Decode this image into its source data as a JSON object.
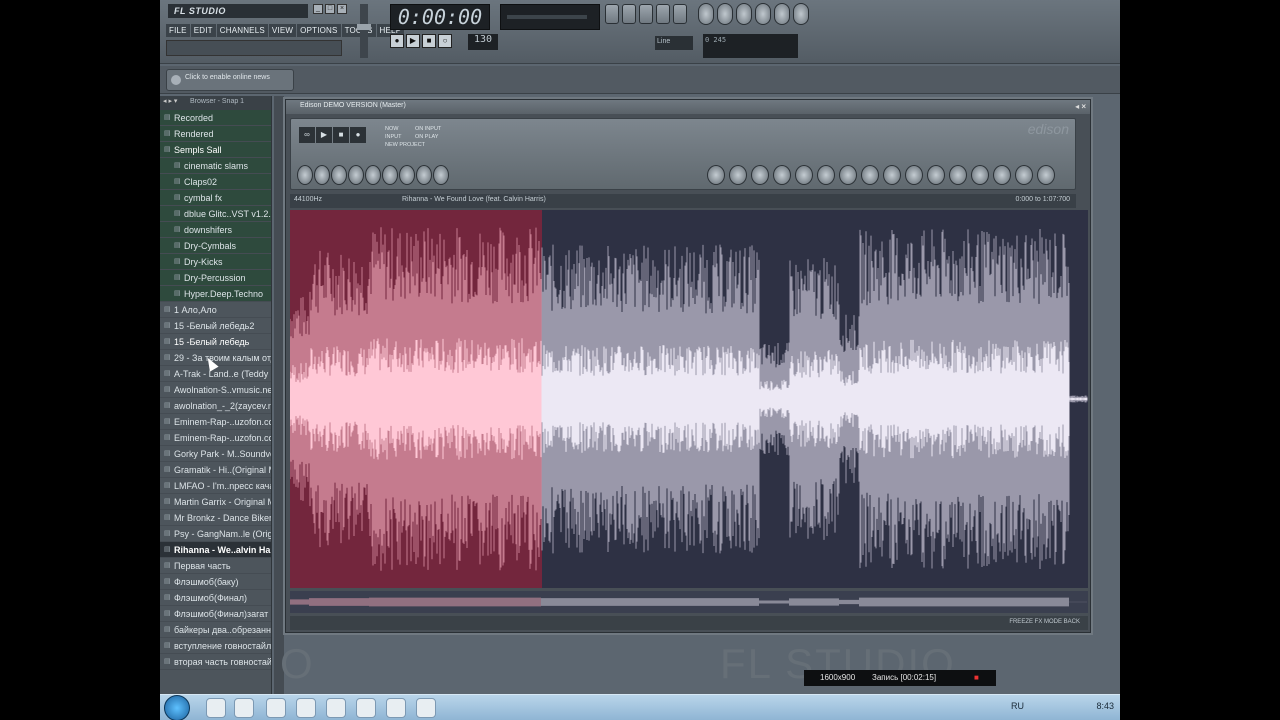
{
  "app": {
    "logo": "FL STUDIO",
    "menu": [
      "FILE",
      "EDIT",
      "CHANNELS",
      "VIEW",
      "OPTIONS",
      "TOOLS",
      "HELP"
    ],
    "time": "0:00:00",
    "tempo": "130",
    "pattern_label": "Line",
    "cpu_readout": "0 245",
    "news": "Click to enable online news"
  },
  "browser": {
    "title": "Browser - Snap 1",
    "items": [
      {
        "label": "Recorded",
        "kind": "folder"
      },
      {
        "label": "Rendered",
        "kind": "folder"
      },
      {
        "label": "Sempls Sall",
        "kind": "folder-bold"
      },
      {
        "label": "cinematic slams",
        "kind": "sub"
      },
      {
        "label": "Claps02",
        "kind": "sub"
      },
      {
        "label": "cymbal fx",
        "kind": "sub"
      },
      {
        "label": "dblue Glitc..VST v1.2.1",
        "kind": "sub"
      },
      {
        "label": "downshifers",
        "kind": "sub"
      },
      {
        "label": "Dry-Cymbals",
        "kind": "sub"
      },
      {
        "label": "Dry-Kicks",
        "kind": "sub"
      },
      {
        "label": "Dry-Percussion",
        "kind": "sub"
      },
      {
        "label": "Hyper.Deep.Techno",
        "kind": "sub"
      },
      {
        "label": "1 Ало,Ало",
        "kind": "file"
      },
      {
        "label": "15 -Белый лебедь2",
        "kind": "file"
      },
      {
        "label": "15 -Белый лебедь",
        "kind": "file-bold"
      },
      {
        "label": "29 - За твоим калым отдам",
        "kind": "file"
      },
      {
        "label": "A-Trak - Land..e (Teddy Mix)",
        "kind": "file"
      },
      {
        "label": "Awolnation-S..vmusic.net)",
        "kind": "file"
      },
      {
        "label": "awolnation_-_2(zaycev.net)",
        "kind": "file"
      },
      {
        "label": "Eminem-Rap-..uzofon.com)",
        "kind": "file"
      },
      {
        "label": "Eminem-Rap-..uzofon.com)",
        "kind": "file"
      },
      {
        "label": "Gorky Park - M..Soundvor.ru",
        "kind": "file"
      },
      {
        "label": "Gramatik - Hi..(Original Mix)",
        "kind": "file"
      },
      {
        "label": "LMFAO - I'm..npecc качать)",
        "kind": "file"
      },
      {
        "label": "Martin Garrix - Original Mix",
        "kind": "file"
      },
      {
        "label": "Mr Bronkz - Dance Bikers",
        "kind": "file"
      },
      {
        "label": "Psy - GangNam..le (Original)",
        "kind": "file"
      },
      {
        "label": "Rihanna - We..alvin Harris)",
        "kind": "selected"
      },
      {
        "label": "Первая часть",
        "kind": "file"
      },
      {
        "label": "Флэшмоб(баку)",
        "kind": "file"
      },
      {
        "label": "Флэшмоб(Финал)",
        "kind": "file"
      },
      {
        "label": "Флэшмоб(Финал)загат",
        "kind": "file"
      },
      {
        "label": "байкеры два..обрезанные",
        "kind": "file"
      },
      {
        "label": "вступление говностайл)",
        "kind": "file"
      },
      {
        "label": "вторая часть говностайла)",
        "kind": "file"
      }
    ]
  },
  "edison": {
    "title": "Edison DEMO VERSION (Master)",
    "brand": "edison",
    "modes": [
      "NOW",
      "INPUT",
      "NEW PROJECT",
      "ON INPUT",
      "ON PLAY"
    ],
    "sample_rate": "44100Hz",
    "track": "Rihanna - We Found Love (feat. Calvin Harris)",
    "range": "0:000 to 1:07:700",
    "status_right": "FREEZE  FX  MODE  BACK"
  },
  "watermark": "FL STUDIO",
  "recorder": {
    "resolution": "1600x900",
    "label": "Запись [00:02:15]"
  },
  "taskbar": {
    "lang": "RU",
    "clock": "8:43"
  }
}
